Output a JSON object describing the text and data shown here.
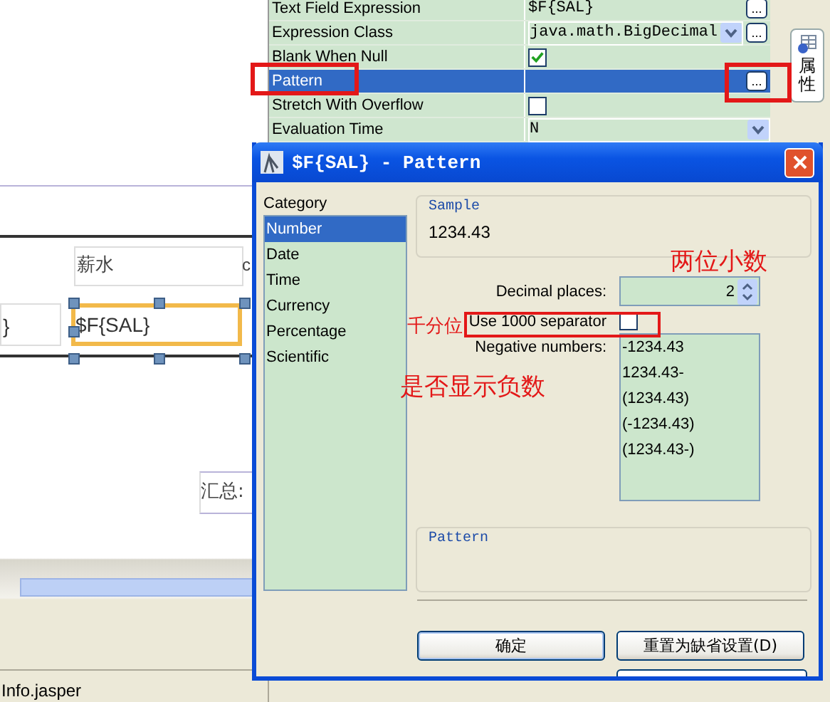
{
  "report": {
    "header_cells": [
      "薪水",
      "c"
    ],
    "detail_cells": [
      {
        "text": "}",
        "selected": false
      },
      {
        "text": "$F{SAL}",
        "selected": true
      }
    ],
    "summary_label": "汇总:"
  },
  "properties": [
    {
      "label": "Text Field Expression",
      "kind": "text",
      "value": "$F{SAL}",
      "more": "...",
      "selected": false
    },
    {
      "label": "Expression Class",
      "kind": "combo",
      "value": "java.math.BigDecimal",
      "more": "...",
      "selected": false
    },
    {
      "label": "Blank When Null",
      "kind": "checkbox",
      "checked": true,
      "selected": false
    },
    {
      "label": "Pattern",
      "kind": "text",
      "more": "...",
      "selected": true
    },
    {
      "label": "Stretch With Overflow",
      "kind": "checkbox",
      "checked": false,
      "selected": false
    },
    {
      "label": "Evaluation Time",
      "kind": "combo",
      "value": "N",
      "selected": false
    }
  ],
  "side_tab": "属性",
  "dialog": {
    "title": "$F{SAL} - Pattern",
    "category_label": "Category",
    "categories": [
      {
        "label": "Number",
        "selected": true
      },
      {
        "label": "Date",
        "selected": false
      },
      {
        "label": "Time",
        "selected": false
      },
      {
        "label": "Currency",
        "selected": false
      },
      {
        "label": "Percentage",
        "selected": false
      },
      {
        "label": "Scientific",
        "selected": false
      }
    ],
    "sample_title": "Sample",
    "sample": "1234.43",
    "decimal_label": "Decimal places:",
    "decimal_value": "2",
    "separator_label": "Use 1000 separator",
    "separator_checked": false,
    "negative_label": "Negative numbers:",
    "negative_options": [
      "-1234.43",
      "1234.43-",
      "(1234.43)",
      "(-1234.43)",
      "(1234.43-)"
    ],
    "pattern_title": "Pattern",
    "buttons": [
      "确定",
      "重置为缺省设置(D)"
    ]
  },
  "annotations": [
    {
      "text": "两位小数"
    },
    {
      "text": "千分位"
    },
    {
      "text": "是否显示负数"
    }
  ],
  "status_bar": "Info.jasper"
}
